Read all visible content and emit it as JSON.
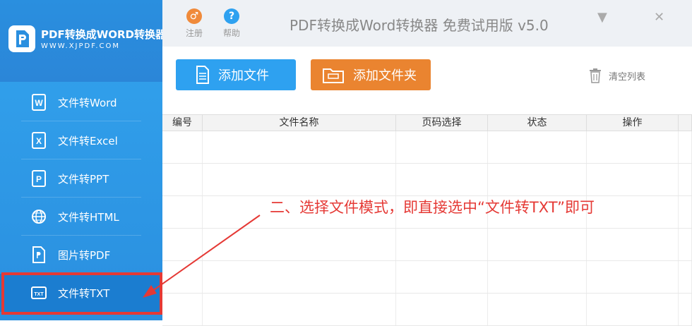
{
  "brand": {
    "title": "PDF转换成WORD转换器",
    "url": "WWW.XJPDF.COM"
  },
  "menu": [
    {
      "label": "文件转Word",
      "icon": "word-icon",
      "letter": "W"
    },
    {
      "label": "文件转Excel",
      "icon": "excel-icon",
      "letter": "X"
    },
    {
      "label": "文件转PPT",
      "icon": "ppt-icon",
      "letter": "P"
    },
    {
      "label": "文件转HTML",
      "icon": "globe-icon",
      "letter": ""
    },
    {
      "label": "图片转PDF",
      "icon": "image-pdf-icon",
      "letter": ""
    },
    {
      "label": "文件转TXT",
      "icon": "txt-icon",
      "letter": "TXT"
    }
  ],
  "topbar": {
    "register": "注册",
    "help": "帮助",
    "title": "PDF转换成Word转换器 免费试用版 v5.0",
    "register_glyph": "♂",
    "help_glyph": "?",
    "minimize_glyph": "▼",
    "close_glyph": "✕"
  },
  "toolbar": {
    "add_file": "添加文件",
    "add_folder": "添加文件夹",
    "clear_list": "清空列表"
  },
  "table": {
    "headers": [
      "编号",
      "文件名称",
      "页码选择",
      "状态",
      "操作"
    ]
  },
  "annotation": "二、选择文件模式，即直接选中“文件转TXT”即可",
  "colors": {
    "sidebar": "#2f9ae8",
    "active": "#1b7dd0",
    "add_file": "#2ea1f0",
    "add_folder": "#ea8430",
    "annotation": "#e53935"
  }
}
